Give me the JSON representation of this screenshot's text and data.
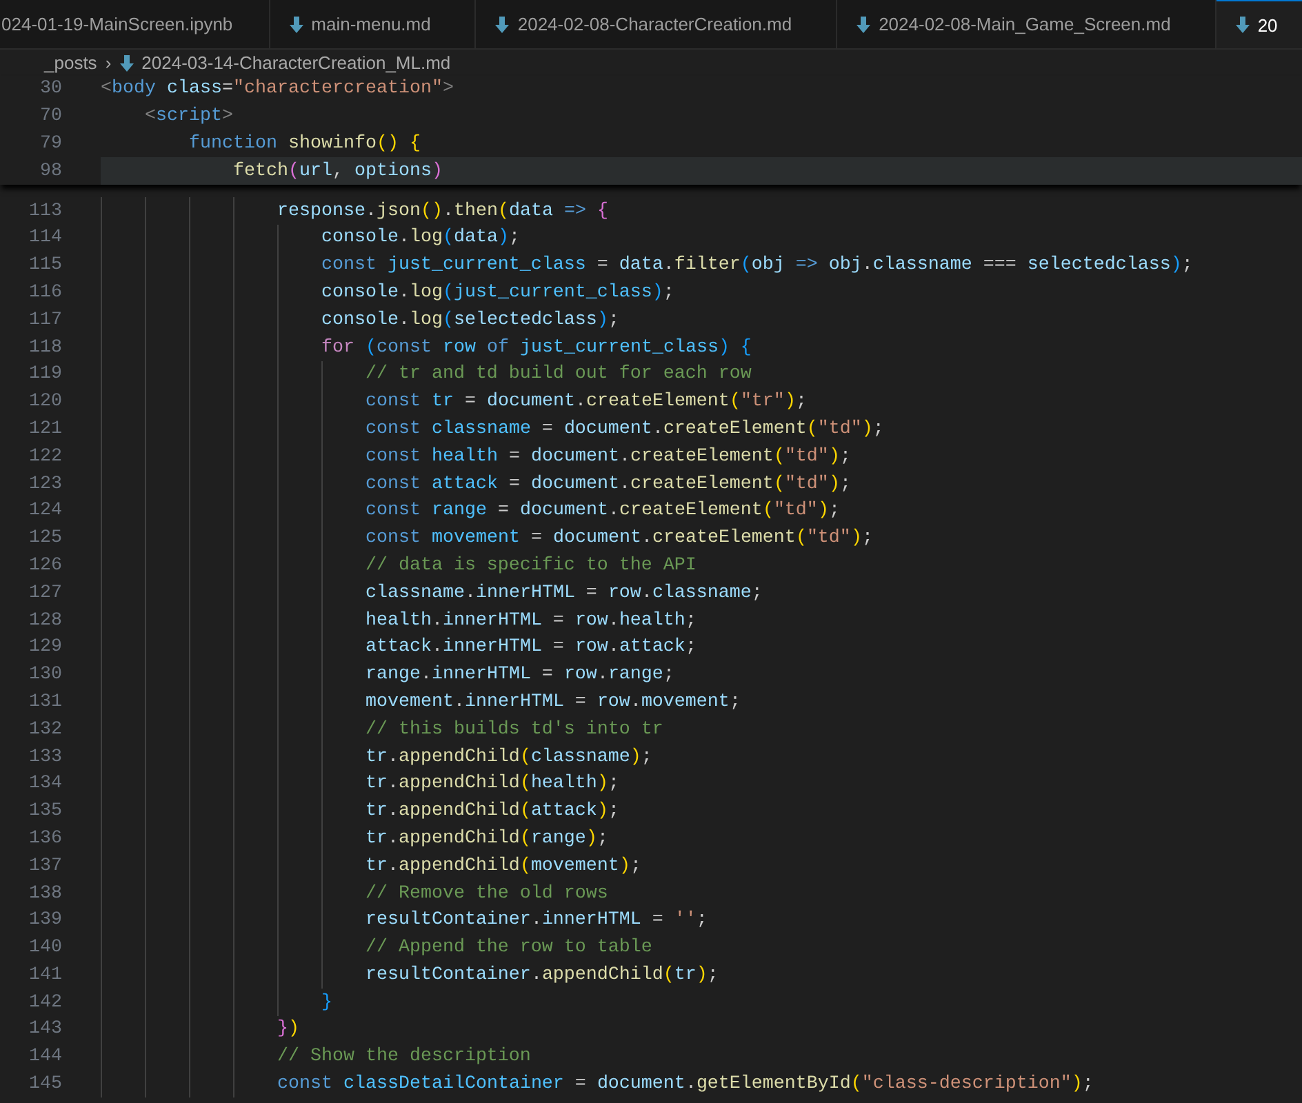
{
  "tabs": [
    {
      "label": "024-01-19-MainScreen.ipynb",
      "icon": false,
      "selected": false
    },
    {
      "label": "main-menu.md",
      "icon": true,
      "selected": false
    },
    {
      "label": "2024-02-08-CharacterCreation.md",
      "icon": true,
      "selected": false
    },
    {
      "label": "2024-02-08-Main_Game_Screen.md",
      "icon": true,
      "selected": false
    },
    {
      "label": "20",
      "icon": true,
      "selected": true
    }
  ],
  "breadcrumb": {
    "folder": "_posts",
    "separator": "›",
    "file": "2024-03-14-CharacterCreation_ML.md"
  },
  "sticky_lines": [
    {
      "number": "30",
      "highlighted": false,
      "tokens": [
        {
          "kind": "tag",
          "text": "<"
        },
        {
          "kind": "tagname",
          "text": "body "
        },
        {
          "kind": "attr",
          "text": "class"
        },
        {
          "kind": "punct",
          "text": "="
        },
        {
          "kind": "str",
          "text": "\"charactercreation\""
        },
        {
          "kind": "tag",
          "text": ">"
        }
      ]
    },
    {
      "number": "70",
      "highlighted": false,
      "tokens": [
        {
          "kind": "tag",
          "text": "    <"
        },
        {
          "kind": "tagname",
          "text": "script"
        },
        {
          "kind": "tag",
          "text": ">"
        }
      ]
    },
    {
      "number": "79",
      "highlighted": false,
      "tokens": [
        {
          "kind": "kw",
          "text": "        function "
        },
        {
          "kind": "fn",
          "text": "showinfo"
        },
        {
          "kind": "br1",
          "text": "() {"
        }
      ]
    },
    {
      "number": "98",
      "highlighted": true,
      "tokens": [
        {
          "kind": "fn",
          "text": "            fetch"
        },
        {
          "kind": "br2",
          "text": "("
        },
        {
          "kind": "var",
          "text": "url"
        },
        {
          "kind": "punct",
          "text": ", "
        },
        {
          "kind": "var",
          "text": "options"
        },
        {
          "kind": "br2",
          "text": ")"
        }
      ]
    }
  ],
  "lines": [
    {
      "number": "113",
      "tokens": [
        {
          "kind": "var",
          "text": "                response"
        },
        {
          "kind": "punct",
          "text": "."
        },
        {
          "kind": "fn",
          "text": "json"
        },
        {
          "kind": "br1",
          "text": "()"
        },
        {
          "kind": "punct",
          "text": "."
        },
        {
          "kind": "fn",
          "text": "then"
        },
        {
          "kind": "br1",
          "text": "("
        },
        {
          "kind": "var",
          "text": "data "
        },
        {
          "kind": "kw",
          "text": "=> "
        },
        {
          "kind": "br2",
          "text": "{"
        }
      ]
    },
    {
      "number": "114",
      "tokens": [
        {
          "kind": "var",
          "text": "                    console"
        },
        {
          "kind": "punct",
          "text": "."
        },
        {
          "kind": "fn",
          "text": "log"
        },
        {
          "kind": "br3",
          "text": "("
        },
        {
          "kind": "var",
          "text": "data"
        },
        {
          "kind": "br3",
          "text": ")"
        },
        {
          "kind": "punct",
          "text": ";"
        }
      ]
    },
    {
      "number": "115",
      "tokens": [
        {
          "kind": "kw",
          "text": "                    const "
        },
        {
          "kind": "const",
          "text": "just_current_class"
        },
        {
          "kind": "punct",
          "text": " = "
        },
        {
          "kind": "var",
          "text": "data"
        },
        {
          "kind": "punct",
          "text": "."
        },
        {
          "kind": "fn",
          "text": "filter"
        },
        {
          "kind": "br3",
          "text": "("
        },
        {
          "kind": "var",
          "text": "obj "
        },
        {
          "kind": "kw",
          "text": "=> "
        },
        {
          "kind": "var",
          "text": "obj"
        },
        {
          "kind": "punct",
          "text": "."
        },
        {
          "kind": "var",
          "text": "classname"
        },
        {
          "kind": "punct",
          "text": " === "
        },
        {
          "kind": "var",
          "text": "selectedclass"
        },
        {
          "kind": "br3",
          "text": ")"
        },
        {
          "kind": "punct",
          "text": ";"
        }
      ]
    },
    {
      "number": "116",
      "tokens": [
        {
          "kind": "var",
          "text": "                    console"
        },
        {
          "kind": "punct",
          "text": "."
        },
        {
          "kind": "fn",
          "text": "log"
        },
        {
          "kind": "br3",
          "text": "("
        },
        {
          "kind": "const",
          "text": "just_current_class"
        },
        {
          "kind": "br3",
          "text": ")"
        },
        {
          "kind": "punct",
          "text": ";"
        }
      ]
    },
    {
      "number": "117",
      "tokens": [
        {
          "kind": "var",
          "text": "                    console"
        },
        {
          "kind": "punct",
          "text": "."
        },
        {
          "kind": "fn",
          "text": "log"
        },
        {
          "kind": "br3",
          "text": "("
        },
        {
          "kind": "var",
          "text": "selectedclass"
        },
        {
          "kind": "br3",
          "text": ")"
        },
        {
          "kind": "punct",
          "text": ";"
        }
      ]
    },
    {
      "number": "118",
      "tokens": [
        {
          "kind": "ctl",
          "text": "                    for "
        },
        {
          "kind": "br3",
          "text": "("
        },
        {
          "kind": "kw",
          "text": "const "
        },
        {
          "kind": "const",
          "text": "row "
        },
        {
          "kind": "kw",
          "text": "of "
        },
        {
          "kind": "const",
          "text": "just_current_class"
        },
        {
          "kind": "br3",
          "text": ") {"
        }
      ]
    },
    {
      "number": "119",
      "tokens": [
        {
          "kind": "cmt",
          "text": "                        // tr and td build out for each row"
        }
      ]
    },
    {
      "number": "120",
      "tokens": [
        {
          "kind": "kw",
          "text": "                        const "
        },
        {
          "kind": "const",
          "text": "tr"
        },
        {
          "kind": "punct",
          "text": " = "
        },
        {
          "kind": "var",
          "text": "document"
        },
        {
          "kind": "punct",
          "text": "."
        },
        {
          "kind": "fn",
          "text": "createElement"
        },
        {
          "kind": "br1",
          "text": "("
        },
        {
          "kind": "str",
          "text": "\"tr\""
        },
        {
          "kind": "br1",
          "text": ")"
        },
        {
          "kind": "punct",
          "text": ";"
        }
      ]
    },
    {
      "number": "121",
      "tokens": [
        {
          "kind": "kw",
          "text": "                        const "
        },
        {
          "kind": "const",
          "text": "classname"
        },
        {
          "kind": "punct",
          "text": " = "
        },
        {
          "kind": "var",
          "text": "document"
        },
        {
          "kind": "punct",
          "text": "."
        },
        {
          "kind": "fn",
          "text": "createElement"
        },
        {
          "kind": "br1",
          "text": "("
        },
        {
          "kind": "str",
          "text": "\"td\""
        },
        {
          "kind": "br1",
          "text": ")"
        },
        {
          "kind": "punct",
          "text": ";"
        }
      ]
    },
    {
      "number": "122",
      "tokens": [
        {
          "kind": "kw",
          "text": "                        const "
        },
        {
          "kind": "const",
          "text": "health"
        },
        {
          "kind": "punct",
          "text": " = "
        },
        {
          "kind": "var",
          "text": "document"
        },
        {
          "kind": "punct",
          "text": "."
        },
        {
          "kind": "fn",
          "text": "createElement"
        },
        {
          "kind": "br1",
          "text": "("
        },
        {
          "kind": "str",
          "text": "\"td\""
        },
        {
          "kind": "br1",
          "text": ")"
        },
        {
          "kind": "punct",
          "text": ";"
        }
      ]
    },
    {
      "number": "123",
      "tokens": [
        {
          "kind": "kw",
          "text": "                        const "
        },
        {
          "kind": "const",
          "text": "attack"
        },
        {
          "kind": "punct",
          "text": " = "
        },
        {
          "kind": "var",
          "text": "document"
        },
        {
          "kind": "punct",
          "text": "."
        },
        {
          "kind": "fn",
          "text": "createElement"
        },
        {
          "kind": "br1",
          "text": "("
        },
        {
          "kind": "str",
          "text": "\"td\""
        },
        {
          "kind": "br1",
          "text": ")"
        },
        {
          "kind": "punct",
          "text": ";"
        }
      ]
    },
    {
      "number": "124",
      "tokens": [
        {
          "kind": "kw",
          "text": "                        const "
        },
        {
          "kind": "const",
          "text": "range"
        },
        {
          "kind": "punct",
          "text": " = "
        },
        {
          "kind": "var",
          "text": "document"
        },
        {
          "kind": "punct",
          "text": "."
        },
        {
          "kind": "fn",
          "text": "createElement"
        },
        {
          "kind": "br1",
          "text": "("
        },
        {
          "kind": "str",
          "text": "\"td\""
        },
        {
          "kind": "br1",
          "text": ")"
        },
        {
          "kind": "punct",
          "text": ";"
        }
      ]
    },
    {
      "number": "125",
      "tokens": [
        {
          "kind": "kw",
          "text": "                        const "
        },
        {
          "kind": "const",
          "text": "movement"
        },
        {
          "kind": "punct",
          "text": " = "
        },
        {
          "kind": "var",
          "text": "document"
        },
        {
          "kind": "punct",
          "text": "."
        },
        {
          "kind": "fn",
          "text": "createElement"
        },
        {
          "kind": "br1",
          "text": "("
        },
        {
          "kind": "str",
          "text": "\"td\""
        },
        {
          "kind": "br1",
          "text": ")"
        },
        {
          "kind": "punct",
          "text": ";"
        }
      ]
    },
    {
      "number": "126",
      "tokens": [
        {
          "kind": "cmt",
          "text": "                        // data is specific to the API"
        }
      ]
    },
    {
      "number": "127",
      "tokens": [
        {
          "kind": "var",
          "text": "                        classname"
        },
        {
          "kind": "punct",
          "text": "."
        },
        {
          "kind": "var",
          "text": "innerHTML"
        },
        {
          "kind": "punct",
          "text": " = "
        },
        {
          "kind": "var",
          "text": "row"
        },
        {
          "kind": "punct",
          "text": "."
        },
        {
          "kind": "var",
          "text": "classname"
        },
        {
          "kind": "punct",
          "text": ";"
        }
      ]
    },
    {
      "number": "128",
      "tokens": [
        {
          "kind": "var",
          "text": "                        health"
        },
        {
          "kind": "punct",
          "text": "."
        },
        {
          "kind": "var",
          "text": "innerHTML"
        },
        {
          "kind": "punct",
          "text": " = "
        },
        {
          "kind": "var",
          "text": "row"
        },
        {
          "kind": "punct",
          "text": "."
        },
        {
          "kind": "var",
          "text": "health"
        },
        {
          "kind": "punct",
          "text": ";"
        }
      ]
    },
    {
      "number": "129",
      "tokens": [
        {
          "kind": "var",
          "text": "                        attack"
        },
        {
          "kind": "punct",
          "text": "."
        },
        {
          "kind": "var",
          "text": "innerHTML"
        },
        {
          "kind": "punct",
          "text": " = "
        },
        {
          "kind": "var",
          "text": "row"
        },
        {
          "kind": "punct",
          "text": "."
        },
        {
          "kind": "var",
          "text": "attack"
        },
        {
          "kind": "punct",
          "text": ";"
        }
      ]
    },
    {
      "number": "130",
      "tokens": [
        {
          "kind": "var",
          "text": "                        range"
        },
        {
          "kind": "punct",
          "text": "."
        },
        {
          "kind": "var",
          "text": "innerHTML"
        },
        {
          "kind": "punct",
          "text": " = "
        },
        {
          "kind": "var",
          "text": "row"
        },
        {
          "kind": "punct",
          "text": "."
        },
        {
          "kind": "var",
          "text": "range"
        },
        {
          "kind": "punct",
          "text": ";"
        }
      ]
    },
    {
      "number": "131",
      "tokens": [
        {
          "kind": "var",
          "text": "                        movement"
        },
        {
          "kind": "punct",
          "text": "."
        },
        {
          "kind": "var",
          "text": "innerHTML"
        },
        {
          "kind": "punct",
          "text": " = "
        },
        {
          "kind": "var",
          "text": "row"
        },
        {
          "kind": "punct",
          "text": "."
        },
        {
          "kind": "var",
          "text": "movement"
        },
        {
          "kind": "punct",
          "text": ";"
        }
      ]
    },
    {
      "number": "132",
      "tokens": [
        {
          "kind": "cmt",
          "text": "                        // this builds td's into tr"
        }
      ]
    },
    {
      "number": "133",
      "tokens": [
        {
          "kind": "var",
          "text": "                        tr"
        },
        {
          "kind": "punct",
          "text": "."
        },
        {
          "kind": "fn",
          "text": "appendChild"
        },
        {
          "kind": "br1",
          "text": "("
        },
        {
          "kind": "var",
          "text": "classname"
        },
        {
          "kind": "br1",
          "text": ")"
        },
        {
          "kind": "punct",
          "text": ";"
        }
      ]
    },
    {
      "number": "134",
      "tokens": [
        {
          "kind": "var",
          "text": "                        tr"
        },
        {
          "kind": "punct",
          "text": "."
        },
        {
          "kind": "fn",
          "text": "appendChild"
        },
        {
          "kind": "br1",
          "text": "("
        },
        {
          "kind": "var",
          "text": "health"
        },
        {
          "kind": "br1",
          "text": ")"
        },
        {
          "kind": "punct",
          "text": ";"
        }
      ]
    },
    {
      "number": "135",
      "tokens": [
        {
          "kind": "var",
          "text": "                        tr"
        },
        {
          "kind": "punct",
          "text": "."
        },
        {
          "kind": "fn",
          "text": "appendChild"
        },
        {
          "kind": "br1",
          "text": "("
        },
        {
          "kind": "var",
          "text": "attack"
        },
        {
          "kind": "br1",
          "text": ")"
        },
        {
          "kind": "punct",
          "text": ";"
        }
      ]
    },
    {
      "number": "136",
      "tokens": [
        {
          "kind": "var",
          "text": "                        tr"
        },
        {
          "kind": "punct",
          "text": "."
        },
        {
          "kind": "fn",
          "text": "appendChild"
        },
        {
          "kind": "br1",
          "text": "("
        },
        {
          "kind": "var",
          "text": "range"
        },
        {
          "kind": "br1",
          "text": ")"
        },
        {
          "kind": "punct",
          "text": ";"
        }
      ]
    },
    {
      "number": "137",
      "tokens": [
        {
          "kind": "var",
          "text": "                        tr"
        },
        {
          "kind": "punct",
          "text": "."
        },
        {
          "kind": "fn",
          "text": "appendChild"
        },
        {
          "kind": "br1",
          "text": "("
        },
        {
          "kind": "var",
          "text": "movement"
        },
        {
          "kind": "br1",
          "text": ")"
        },
        {
          "kind": "punct",
          "text": ";"
        }
      ]
    },
    {
      "number": "138",
      "tokens": [
        {
          "kind": "cmt",
          "text": "                        // Remove the old rows"
        }
      ]
    },
    {
      "number": "139",
      "tokens": [
        {
          "kind": "var",
          "text": "                        resultContainer"
        },
        {
          "kind": "punct",
          "text": "."
        },
        {
          "kind": "var",
          "text": "innerHTML"
        },
        {
          "kind": "punct",
          "text": " = "
        },
        {
          "kind": "str",
          "text": "''"
        },
        {
          "kind": "punct",
          "text": ";"
        }
      ]
    },
    {
      "number": "140",
      "tokens": [
        {
          "kind": "cmt",
          "text": "                        // Append the row to table"
        }
      ]
    },
    {
      "number": "141",
      "tokens": [
        {
          "kind": "var",
          "text": "                        resultContainer"
        },
        {
          "kind": "punct",
          "text": "."
        },
        {
          "kind": "fn",
          "text": "appendChild"
        },
        {
          "kind": "br1",
          "text": "("
        },
        {
          "kind": "var",
          "text": "tr"
        },
        {
          "kind": "br1",
          "text": ")"
        },
        {
          "kind": "punct",
          "text": ";"
        }
      ]
    },
    {
      "number": "142",
      "tokens": [
        {
          "kind": "br3",
          "text": "                    }"
        }
      ]
    },
    {
      "number": "143",
      "tokens": [
        {
          "kind": "br2",
          "text": "                }"
        },
        {
          "kind": "br1",
          "text": ")"
        }
      ]
    },
    {
      "number": "144",
      "tokens": [
        {
          "kind": "cmt",
          "text": "                // Show the description"
        }
      ]
    },
    {
      "number": "145",
      "tokens": [
        {
          "kind": "kw",
          "text": "                const "
        },
        {
          "kind": "const",
          "text": "classDetailContainer"
        },
        {
          "kind": "punct",
          "text": " = "
        },
        {
          "kind": "var",
          "text": "document"
        },
        {
          "kind": "punct",
          "text": "."
        },
        {
          "kind": "fn",
          "text": "getElementById"
        },
        {
          "kind": "br1",
          "text": "("
        },
        {
          "kind": "str",
          "text": "\"class-description\""
        },
        {
          "kind": "br1",
          "text": ")"
        },
        {
          "kind": "punct",
          "text": ";"
        }
      ]
    }
  ]
}
